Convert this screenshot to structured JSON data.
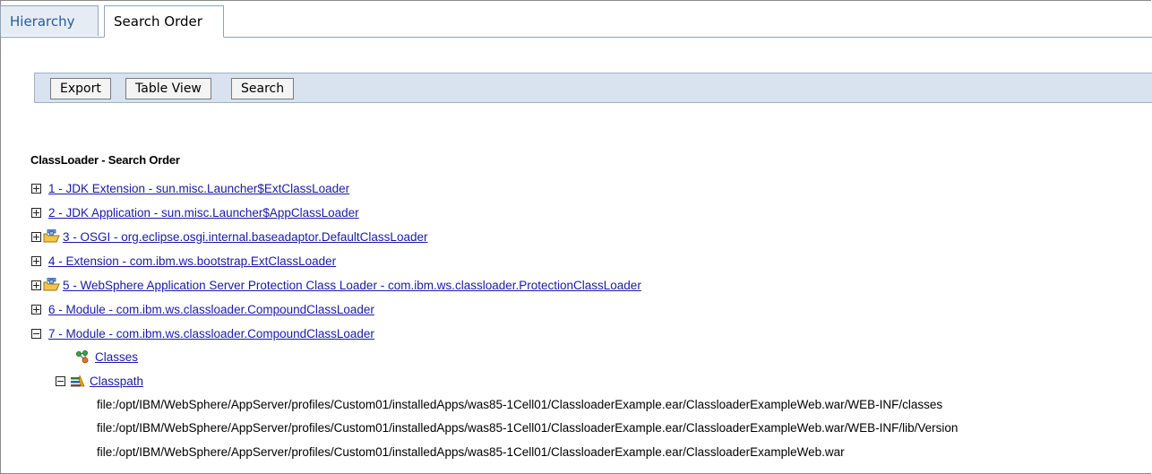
{
  "tabs": [
    {
      "label": "Hierarchy"
    },
    {
      "label": "Search Order"
    }
  ],
  "toolbar": {
    "export_label": "Export",
    "table_view_label": "Table View",
    "search_label": "Search"
  },
  "heading": "ClassLoader - Search Order",
  "entries": [
    {
      "label": "1 - JDK Extension - sun.misc.Launcher$ExtClassLoader"
    },
    {
      "label": "2 - JDK Application - sun.misc.Launcher$AppClassLoader"
    },
    {
      "label": "3 - OSGI - org.eclipse.osgi.internal.baseadaptor.DefaultClassLoader"
    },
    {
      "label": "4 - Extension - com.ibm.ws.bootstrap.ExtClassLoader"
    },
    {
      "label": "5 - WebSphere Application Server Protection Class Loader - com.ibm.ws.classloader.ProtectionClassLoader"
    },
    {
      "label": "6 - Module - com.ibm.ws.classloader.CompoundClassLoader"
    },
    {
      "label": "7 - Module - com.ibm.ws.classloader.CompoundClassLoader"
    }
  ],
  "children": {
    "classes_label": "Classes",
    "classpath_label": "Classpath",
    "classpath_items": [
      "file:/opt/IBM/WebSphere/AppServer/profiles/Custom01/installedApps/was85-1Cell01/ClassloaderExample.ear/ClassloaderExampleWeb.war/WEB-INF/classes",
      "file:/opt/IBM/WebSphere/AppServer/profiles/Custom01/installedApps/was85-1Cell01/ClassloaderExample.ear/ClassloaderExampleWeb.war/WEB-INF/lib/Version",
      "file:/opt/IBM/WebSphere/AppServer/profiles/Custom01/installedApps/was85-1Cell01/ClassloaderExample.ear/ClassloaderExampleWeb.war"
    ]
  }
}
